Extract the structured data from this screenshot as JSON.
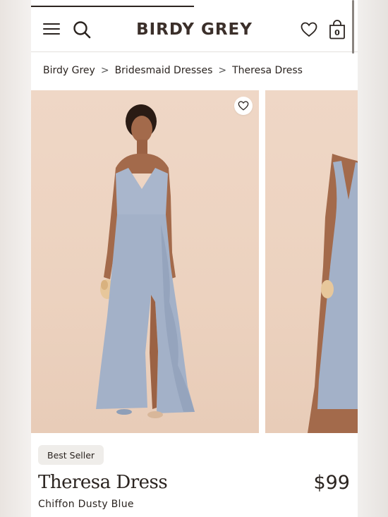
{
  "brand": {
    "name": "BIRDY GREY"
  },
  "header": {
    "cart_count": "0"
  },
  "breadcrumb": [
    {
      "label": "Birdy Grey"
    },
    {
      "label": "Bridesmaid Dresses"
    },
    {
      "label": "Theresa Dress"
    }
  ],
  "breadcrumb_separator": ">",
  "product": {
    "badge": "Best Seller",
    "title": "Theresa Dress",
    "price": "$99",
    "variant": "Chiffon Dusty Blue"
  },
  "colors": {
    "accent": "#2d2420",
    "dress": "#a9b6cc",
    "backdrop": "#ecd2bf"
  },
  "icons": [
    "menu-icon",
    "search-icon",
    "heart-icon",
    "bag-icon",
    "heart-outline-icon"
  ]
}
